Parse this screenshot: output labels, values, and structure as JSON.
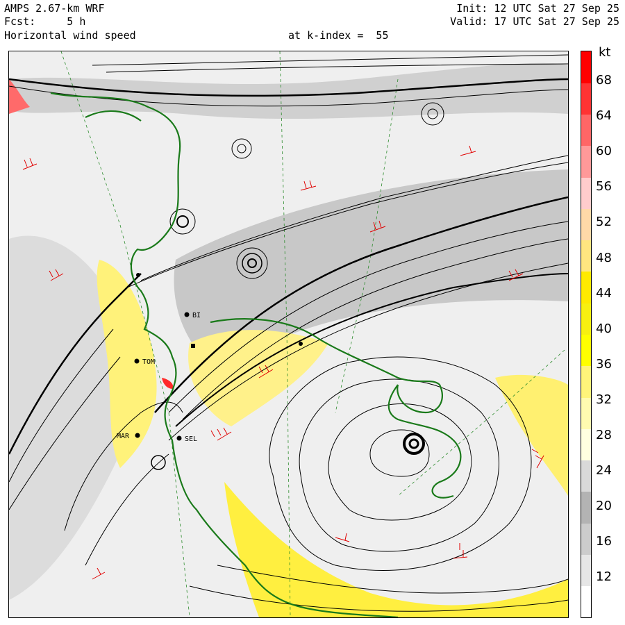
{
  "header": {
    "model": "AMPS 2.67-km WRF",
    "forecast": "Fcst:     5 h",
    "field": "Horizontal wind speed",
    "level": "at k-index =  55",
    "init": "Init: 12 UTC Sat 27 Sep 25",
    "valid": "Valid: 17 UTC Sat 27 Sep 25"
  },
  "colorbar": {
    "unit": "kt",
    "ticks": [
      "68",
      "64",
      "60",
      "56",
      "52",
      "48",
      "44",
      "40",
      "36",
      "32",
      "28",
      "24",
      "20",
      "16",
      "12"
    ],
    "colors": [
      "#ffffff",
      "#e6e6e6",
      "#cccccc",
      "#b3b3b3",
      "#d9d9d9",
      "#ffffe0",
      "#fffbb0",
      "#fff47a",
      "#ffff00",
      "#f8f010",
      "#ffea00",
      "#ffe680",
      "#ffd9a8",
      "#ffcccc",
      "#ff9999",
      "#ff6666",
      "#ff3333",
      "#ff0000"
    ]
  },
  "map": {
    "stations": [
      {
        "label": "BI"
      },
      {
        "label": "TOM"
      },
      {
        "label": "MAR"
      },
      {
        "label": "SEL"
      }
    ],
    "colors": {
      "coastline": "#1a7a1a",
      "streamline": "#000000",
      "barb": "#e00000",
      "grid": "#2a8a2a"
    }
  }
}
